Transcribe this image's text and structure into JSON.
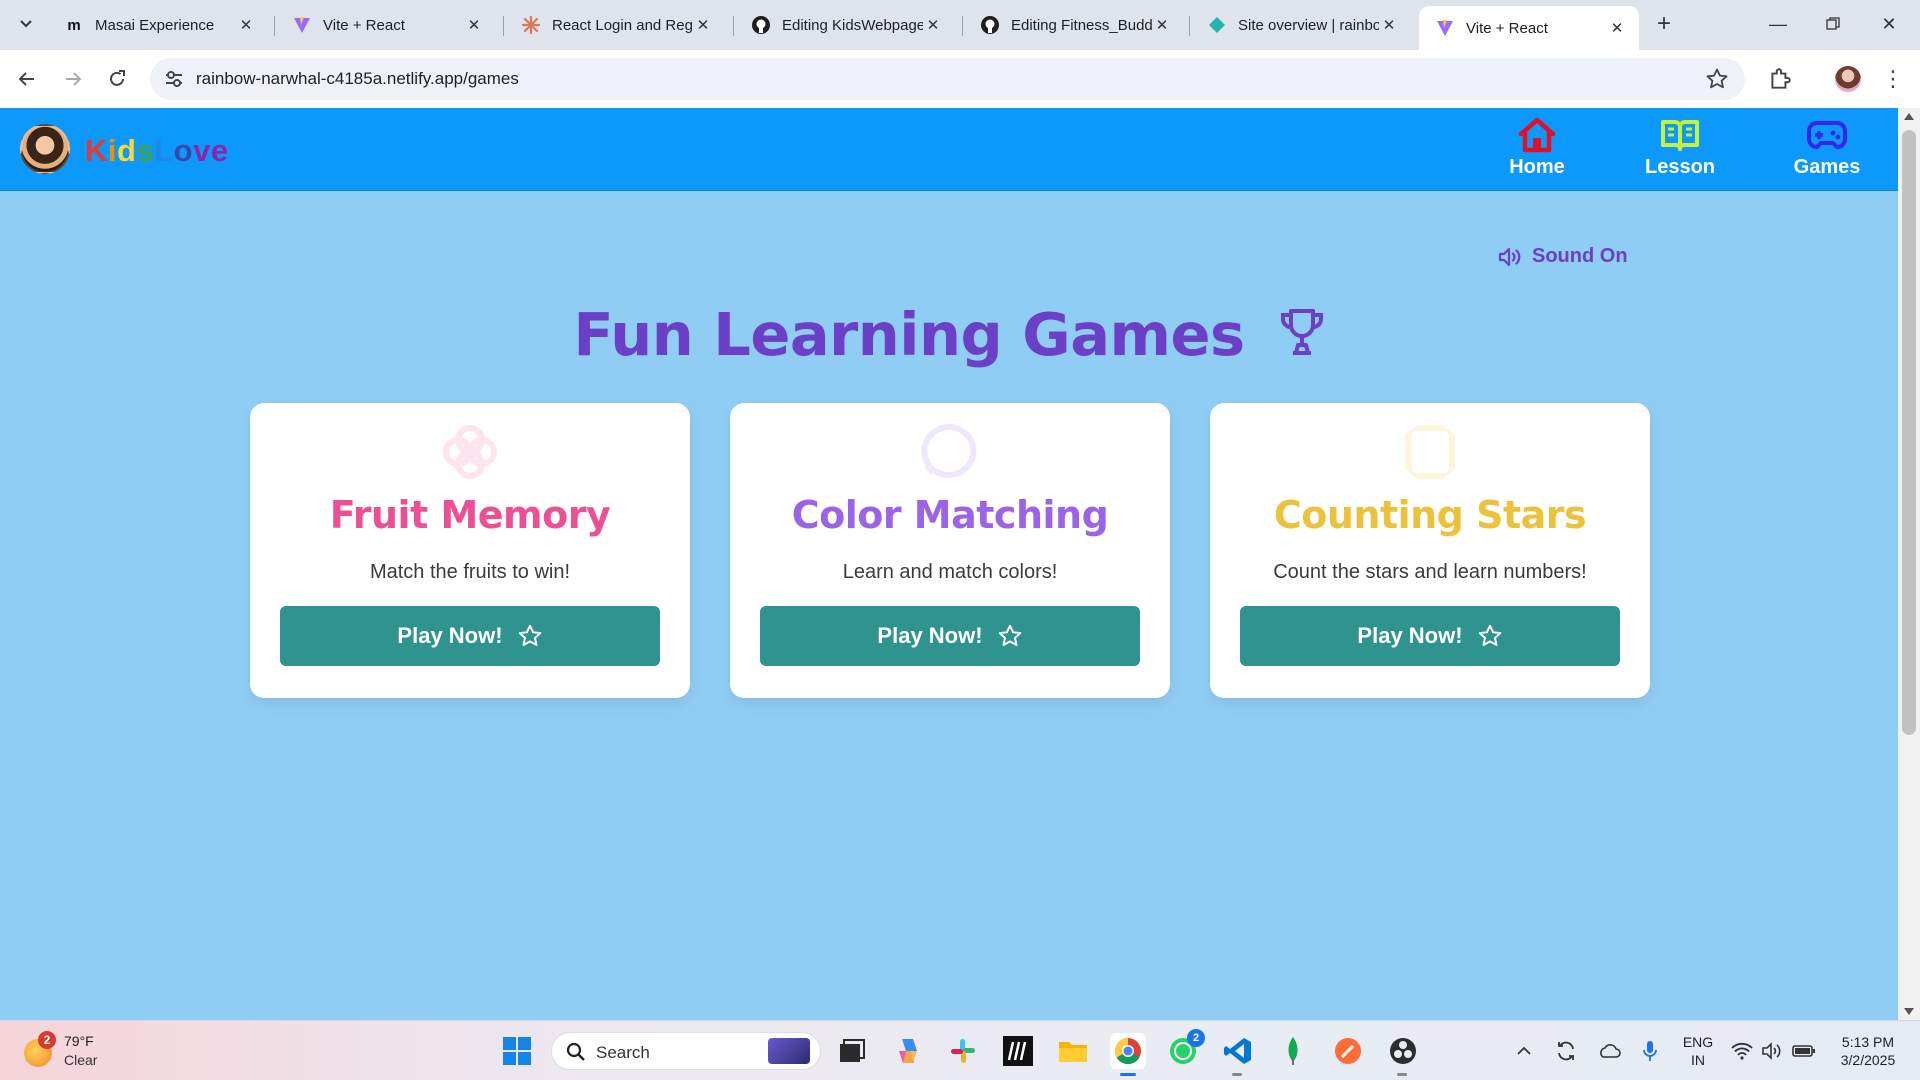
{
  "browser": {
    "tabs": [
      {
        "title": "Masai Experience",
        "favicon": "masai-m-icon"
      },
      {
        "title": "Vite + React",
        "favicon": "vite-icon"
      },
      {
        "title": "React Login and Regi",
        "favicon": "claude-sunburst-icon"
      },
      {
        "title": "Editing KidsWebpage",
        "favicon": "github-icon"
      },
      {
        "title": "Editing Fitness_Budd",
        "favicon": "github-icon"
      },
      {
        "title": "Site overview | rainbo",
        "favicon": "netlify-icon"
      },
      {
        "title": "Vite + React",
        "favicon": "vite-icon",
        "active": true
      }
    ],
    "url": "rainbow-narwhal-c4185a.netlify.app/games"
  },
  "site": {
    "logo_text": [
      "K",
      "i",
      "d",
      "s",
      "L",
      "o",
      "v",
      "e"
    ],
    "logo_colors": [
      "#e53935",
      "#fb8c00",
      "#fdd835",
      "#43a047",
      "#1e88e5",
      "#3949ab",
      "#8e24aa",
      "#8e24aa"
    ],
    "nav": [
      {
        "label": "Home",
        "icon": "home-icon",
        "color": "#e0102b"
      },
      {
        "label": "Lesson",
        "icon": "book-open-icon",
        "color": "#c6f03a"
      },
      {
        "label": "Games",
        "icon": "gamepad-icon",
        "color": "#3527e8"
      }
    ],
    "sound_label": "Sound On",
    "title": "Fun Learning Games",
    "cards": [
      {
        "title": "Fruit Memory",
        "description": "Match the fruits to win!",
        "button": "Play Now!",
        "color": "#ec4f94",
        "icon": "flower-icon",
        "icon_color": "#fde4ef"
      },
      {
        "title": "Color Matching",
        "description": "Learn and match colors!",
        "button": "Play Now!",
        "color": "#9a63e8",
        "icon": "chat-bubble-icon",
        "icon_color": "#efe7fc"
      },
      {
        "title": "Counting Stars",
        "description": "Count the stars and learn numbers!",
        "button": "Play Now!",
        "color": "#ecc13c",
        "icon": "square-icon",
        "icon_color": "#fdf5dc"
      }
    ]
  },
  "taskbar": {
    "weather_temp": "79°F",
    "weather_cond": "Clear",
    "weather_badge": "2",
    "search_placeholder": "Search",
    "whatsapp_badge": "2",
    "lang_line1": "ENG",
    "lang_line2": "IN",
    "time": "5:13 PM",
    "date": "3/2/2025"
  }
}
